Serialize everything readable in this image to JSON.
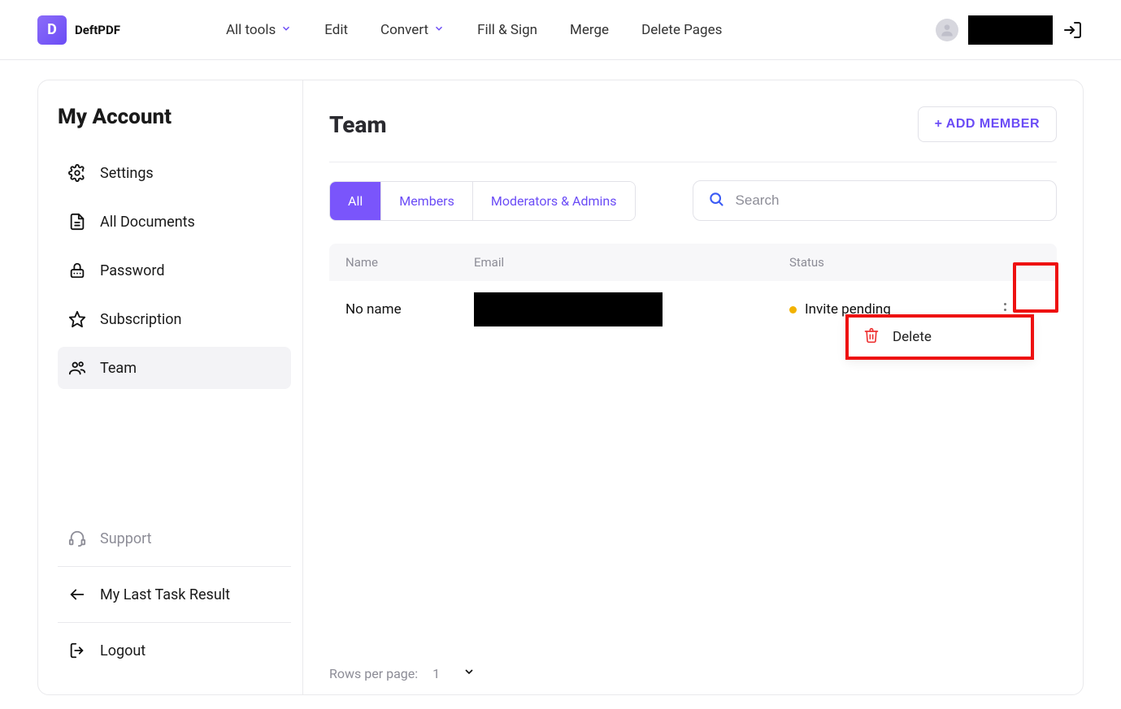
{
  "brand": {
    "mark": "D",
    "name": "DeftPDF"
  },
  "nav": {
    "all_tools": "All tools",
    "edit": "Edit",
    "convert": "Convert",
    "fill_sign": "Fill & Sign",
    "merge": "Merge",
    "delete_pages": "Delete Pages"
  },
  "sidebar": {
    "title": "My Account",
    "items": [
      {
        "label": "Settings"
      },
      {
        "label": "All Documents"
      },
      {
        "label": "Password"
      },
      {
        "label": "Subscription"
      },
      {
        "label": "Team"
      }
    ],
    "support": "Support",
    "last_task": "My Last Task Result",
    "logout": "Logout"
  },
  "page": {
    "title": "Team",
    "add_member": "+ ADD MEMBER",
    "tabs": {
      "all": "All",
      "members": "Members",
      "mods": "Moderators & Admins"
    },
    "search_placeholder": "Search",
    "columns": {
      "name": "Name",
      "email": "Email",
      "status": "Status"
    },
    "row": {
      "name": "No name",
      "status": "Invite pending"
    },
    "menu": {
      "delete": "Delete"
    },
    "footer": {
      "rows_label": "Rows per page:",
      "rows_value": "1"
    }
  }
}
